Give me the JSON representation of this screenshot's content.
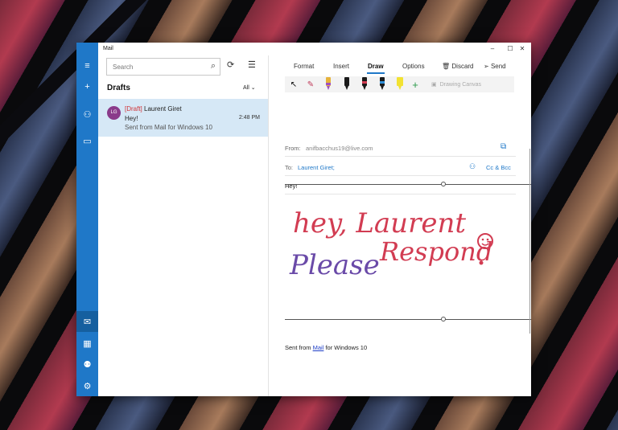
{
  "window": {
    "title": "Mail",
    "minimize": "–",
    "maximize": "☐",
    "close": "✕"
  },
  "rail": {
    "menu_icon": "≡",
    "new_icon": "+",
    "accounts_icon": "⚇",
    "folders_icon": "▭",
    "mail_icon": "✉",
    "calendar_icon": "▦",
    "people_icon": "⚉",
    "settings_icon": "⚙"
  },
  "list": {
    "search_placeholder": "Search",
    "search_icon": "⌕",
    "sync_icon": "⟳",
    "select_icon": "☰",
    "folder_title": "Drafts",
    "filter_label": "All",
    "filter_icon": "⌄",
    "messages": [
      {
        "avatar_initials": "LG",
        "tag": "[Draft]",
        "sender": "Laurent Giret",
        "subject": "Hey!",
        "preview": "Sent from Mail for Windows 10",
        "time": "2:48 PM"
      }
    ]
  },
  "compose": {
    "tabs": {
      "format": "Format",
      "insert": "Insert",
      "draw": "Draw",
      "options": "Options"
    },
    "discard_label": "Discard",
    "discard_icon": "🗑",
    "send_label": "Send",
    "send_icon": "➢",
    "draw_tools": {
      "select_icon": "↖",
      "eraser_icon": "✎",
      "add_pen_icon": "+",
      "canvas_icon": "▣",
      "canvas_label": "Drawing Canvas"
    },
    "from_label": "From:",
    "from_value": "anifbacchus19@live.com",
    "popout_icon": "⧉",
    "to_label": "To:",
    "to_value": "Laurent Giret;",
    "contacts_icon": "⚇",
    "cc_bcc": "Cc & Bcc",
    "subject": "Hey!",
    "signature_prefix": "Sent from ",
    "signature_link": "Mail",
    "signature_suffix": " for Windows 10"
  },
  "ink": {
    "line1": "hey, Laurent",
    "line2_a": "Please",
    "line2_b": "Respond",
    "colors": {
      "red": "#d23c52",
      "purple": "#6a4aa8",
      "blue": "#2f8fd8"
    }
  },
  "colors": {
    "accent": "#1f78c8",
    "selected_row": "#d6e8f6",
    "draft_tag": "#d13438"
  }
}
